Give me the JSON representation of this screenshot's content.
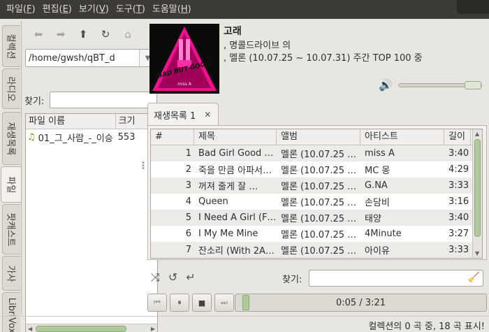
{
  "menu": [
    {
      "label": "파일(",
      "key": "F",
      "end": ")"
    },
    {
      "label": "편집(",
      "key": "E",
      "end": ")"
    },
    {
      "label": "보기(",
      "key": "V",
      "end": ")"
    },
    {
      "label": "도구(",
      "key": "T",
      "end": ")"
    },
    {
      "label": "도움말(",
      "key": "H",
      "end": ")"
    }
  ],
  "side_tabs": [
    "컬렉션",
    "라디오",
    "재생목록",
    "파일",
    "팟캐스트",
    "가사",
    "LibriVox"
  ],
  "file_browser": {
    "path": "/home/gwsh/qBT_d",
    "find_label": "찾기:",
    "find_value": "",
    "columns": [
      "파일 이름",
      "크기"
    ],
    "rows": [
      {
        "name": "01_그_사람_-_이승",
        "size": "553"
      }
    ]
  },
  "now_playing": {
    "title": "고래",
    "line1": ", 명콜드라이브 의",
    "line2": ", 멜론 (10.07.25 ~ 10.07.31) 주간 TOP 100 중",
    "album_art_text": "BAD BUT GOOD",
    "album_art_sub": "miss A",
    "volume_level": 1.0
  },
  "playlist": {
    "tab_label": "재생목록 1",
    "columns": [
      "#",
      "제목",
      "앨범",
      "아티스트",
      "길이"
    ],
    "rows": [
      {
        "num": "1",
        "title": "Bad Girl Good …",
        "album": "멜론 (10.07.25 …",
        "artist": "miss A",
        "length": "3:40"
      },
      {
        "num": "2",
        "title": "죽을 만큼 아파서…",
        "album": "멜론 (10.07.25 …",
        "artist": "MC 몽",
        "length": "4:29"
      },
      {
        "num": "3",
        "title": "꺼져 줄게 잘 …",
        "album": "멜론 (10.07.25 …",
        "artist": "G.NA",
        "length": "3:33"
      },
      {
        "num": "4",
        "title": "Queen",
        "album": "멜론 (10.07.25 …",
        "artist": "손담비",
        "length": "3:16"
      },
      {
        "num": "5",
        "title": "I Need A Girl (F…",
        "album": "멜론 (10.07.25 …",
        "artist": "태양",
        "length": "3:40"
      },
      {
        "num": "6",
        "title": "I My Me Mine",
        "album": "멜론 (10.07.25 …",
        "artist": "4Minute",
        "length": "3:27"
      },
      {
        "num": "7",
        "title": "잔소리 (With 2A…",
        "album": "멜론 (10.07.25 …",
        "artist": "아이유",
        "length": "3:33"
      }
    ],
    "find_label": "찾기:",
    "find_value": ""
  },
  "player": {
    "time": "0:05 / 3:21",
    "progress": 0.025
  },
  "status": "컬렉션의 0 곡 중, 18 곡 표시!"
}
